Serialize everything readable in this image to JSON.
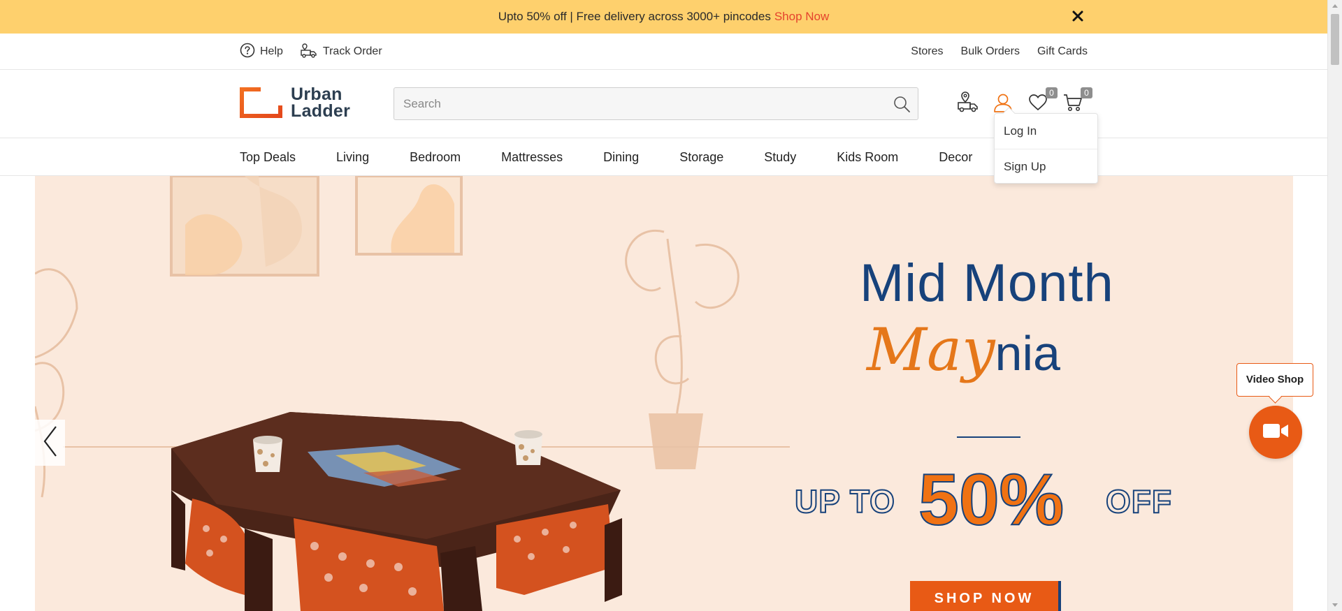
{
  "promo": {
    "text": "Upto 50% off | Free delivery across 3000+ pincodes",
    "link": "Shop Now"
  },
  "utility": {
    "help": "Help",
    "track_order": "Track Order",
    "right_links": [
      "Stores",
      "Bulk Orders",
      "Gift Cards"
    ]
  },
  "brand": {
    "line1": "Urban",
    "line2": "Ladder",
    "accent_color": "#f07213"
  },
  "search": {
    "placeholder": "Search",
    "value": ""
  },
  "header_icons": {
    "wishlist_count": "0",
    "cart_count": "0"
  },
  "nav": {
    "items": [
      "Top Deals",
      "Living",
      "Bedroom",
      "Mattresses",
      "Dining",
      "Storage",
      "Study",
      "Kids Room",
      "Decor"
    ]
  },
  "account_menu": {
    "login": "Log In",
    "signup": "Sign Up"
  },
  "hero": {
    "headline_1": "Mid Month",
    "headline_2a": "May",
    "headline_2b": "nia",
    "up_to": "UP TO",
    "percent": "50%",
    "off": "OFF",
    "cta": "SHOP NOW",
    "navy": "#17427b",
    "orange": "#e85a15"
  },
  "video_shop": {
    "label": "Video Shop"
  }
}
